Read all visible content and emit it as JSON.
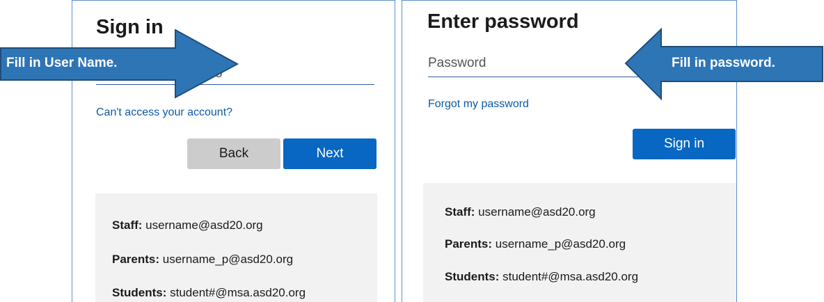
{
  "left": {
    "title": "Sign in",
    "email_placeholder": "user@msa.asd20.org",
    "cant_access_label": "Can't access your account?",
    "back_label": "Back",
    "next_label": "Next",
    "hints": [
      {
        "role": "Staff:",
        "value": " username@asd20.org"
      },
      {
        "role": "Parents:",
        "value": " username_p@asd20.org"
      },
      {
        "role": "Students:",
        "value": " student#@msa.asd20.org"
      }
    ],
    "callout": "Fill in User Name."
  },
  "right": {
    "title": "Enter password",
    "password_placeholder": "Password",
    "forgot_label": "Forgot my password",
    "signin_label": "Sign in",
    "hints": [
      {
        "role": "Staff:",
        "value": " username@asd20.org"
      },
      {
        "role": "Parents:",
        "value": " username_p@asd20.org"
      },
      {
        "role": "Students:",
        "value": " student#@msa.asd20.org"
      }
    ],
    "callout": "Fill in password."
  },
  "colors": {
    "accent": "#0767c2",
    "callout_fill": "#2e75b6",
    "callout_stroke": "#1f4e79",
    "link": "#0a5aa8"
  }
}
